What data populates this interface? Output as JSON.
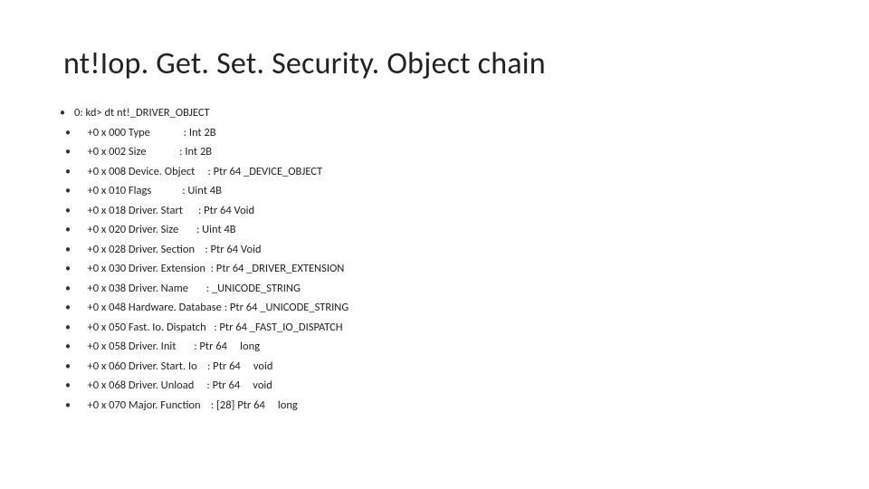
{
  "title": "nt!Iop. Get. Set. Security. Object chain",
  "lines": [
    "0: kd> dt nt!_DRIVER_OBJECT",
    "   +0 x 000 Type             : Int 2B",
    "   +0 x 002 Size             : Int 2B",
    "   +0 x 008 Device. Object     : Ptr 64 _DEVICE_OBJECT",
    "   +0 x 010 Flags            : Uint 4B",
    "   +0 x 018 Driver. Start      : Ptr 64 Void",
    "   +0 x 020 Driver. Size       : Uint 4B",
    "   +0 x 028 Driver. Section    : Ptr 64 Void",
    "   +0 x 030 Driver. Extension  : Ptr 64 _DRIVER_EXTENSION",
    "   +0 x 038 Driver. Name       : _UNICODE_STRING",
    "   +0 x 048 Hardware. Database : Ptr 64 _UNICODE_STRING",
    "   +0 x 050 Fast. Io. Dispatch   : Ptr 64 _FAST_IO_DISPATCH",
    "   +0 x 058 Driver. Init       : Ptr 64     long",
    "   +0 x 060 Driver. Start. Io    : Ptr 64     void",
    "   +0 x 068 Driver. Unload     : Ptr 64     void",
    "   +0 x 070 Major. Function    : [28] Ptr 64     long"
  ]
}
